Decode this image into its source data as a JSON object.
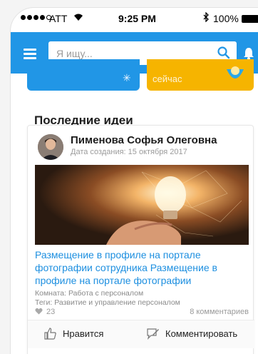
{
  "status_bar": {
    "carrier": "ATT",
    "time": "9:25 PM",
    "battery": "100%"
  },
  "app_bar": {
    "search_placeholder": "Я ищу..."
  },
  "tiles": {
    "yellow_caption": "сейчас"
  },
  "section": {
    "title": "Последние идеи"
  },
  "idea": {
    "author": "Пименова Софья Олеговна",
    "created": "Дата создания: 15 октября 2017",
    "title": "Размещение в профиле на портале фотографии сотрудника Размещение в профиле на портале фотографии",
    "room": "Комната: Работа с персоналом",
    "tags": "Теги: Развитие и управление персоналом",
    "likes": "23",
    "comments": "8 комментариев",
    "like_label": "Нравится",
    "comment_label": "Комментировать"
  },
  "colors": {
    "primary": "#2196e6",
    "accent": "#f6b400",
    "link": "#1d8fe0"
  }
}
